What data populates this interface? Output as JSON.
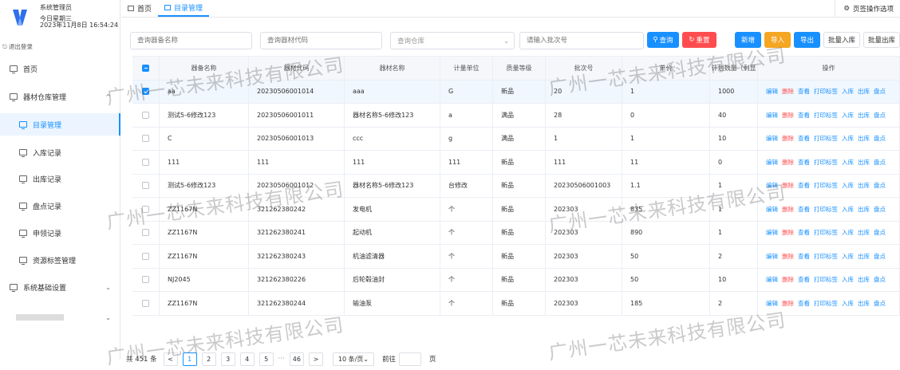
{
  "user": {
    "name": "系统管理员",
    "day": "今日星期三",
    "datetime": "2023年11月8日 16:54:24",
    "logout": "退出登录"
  },
  "sidebar": {
    "items": [
      {
        "label": "首页",
        "level": "top"
      },
      {
        "label": "器材仓库管理",
        "level": "top",
        "chevron": "^"
      },
      {
        "label": "目录管理",
        "level": "sub",
        "active": true
      },
      {
        "label": "入库记录",
        "level": "sub"
      },
      {
        "label": "出库记录",
        "level": "sub"
      },
      {
        "label": "盘点记录",
        "level": "sub"
      },
      {
        "label": "申领记录",
        "level": "sub"
      },
      {
        "label": "资源标签管理",
        "level": "sub"
      },
      {
        "label": "系统基础设置",
        "level": "top",
        "chevron": "⌄"
      }
    ]
  },
  "tabs": [
    {
      "label": "首页"
    },
    {
      "label": "目录管理",
      "active": true
    }
  ],
  "tab_options": "页签操作选项",
  "filters": {
    "name_placeholder": "查询器备名称",
    "code_placeholder": "查询器材代码",
    "warehouse_placeholder": "查询仓库",
    "batch_placeholder": "请输入批次号"
  },
  "buttons": {
    "search": "查询",
    "reset": "重置",
    "add": "新增",
    "import": "导入",
    "export": "导出",
    "batch_in": "批量入库",
    "batch_out": "批量出库"
  },
  "table": {
    "headers": [
      "器备名称",
      "器材代码",
      "器材名称",
      "计量单位",
      "质量等级",
      "批次号",
      "单价",
      "计划数量（剩显",
      "操作"
    ],
    "rows": [
      {
        "c": [
          "aa",
          "20230506001014",
          "aaa",
          "G",
          "新品",
          "20",
          "1",
          "1000"
        ],
        "checked": true
      },
      {
        "c": [
          "测试5-6修改123",
          "20230506001011",
          "器材名称5-6修改123",
          "a",
          "满品",
          "28",
          "0",
          "40"
        ]
      },
      {
        "c": [
          "C",
          "20230506001013",
          "ccc",
          "g",
          "满品",
          "1",
          "1",
          "10"
        ]
      },
      {
        "c": [
          "111",
          "111",
          "111",
          "111",
          "新品",
          "111",
          "11",
          "0"
        ]
      },
      {
        "c": [
          "测试5-6修改123",
          "20230506001012",
          "器材名称5-6修改123",
          "台修改",
          "新品",
          "20230506001003",
          "1.1",
          "1"
        ]
      },
      {
        "c": [
          "ZZ1167N",
          "321262380242",
          "发电机",
          "个",
          "新品",
          "202303",
          "835",
          "1"
        ]
      },
      {
        "c": [
          "ZZ1167N",
          "321262380241",
          "起动机",
          "个",
          "新品",
          "202303",
          "890",
          "1"
        ]
      },
      {
        "c": [
          "ZZ1167N",
          "321262380243",
          "机油滤清器",
          "个",
          "新品",
          "202303",
          "50",
          "2"
        ]
      },
      {
        "c": [
          "NJ2045",
          "321262380226",
          "后轮毂油封",
          "个",
          "新品",
          "202303",
          "50",
          "10"
        ]
      },
      {
        "c": [
          "ZZ1167N",
          "321262380244",
          "输油泵",
          "个",
          "新品",
          "202303",
          "185",
          "2"
        ]
      }
    ],
    "actions": [
      "编辑",
      "删除",
      "查看",
      "打印标签",
      "入库",
      "出库",
      "盘点"
    ]
  },
  "pagination": {
    "total": "共 451 条",
    "pages": [
      "1",
      "2",
      "3",
      "4",
      "5",
      "···",
      "46"
    ],
    "prev": "<",
    "next": ">",
    "size": "10 条/页",
    "goto": "前往",
    "unit": "页",
    "current": "1"
  },
  "watermark": "广州一芯未来科技有限公司"
}
